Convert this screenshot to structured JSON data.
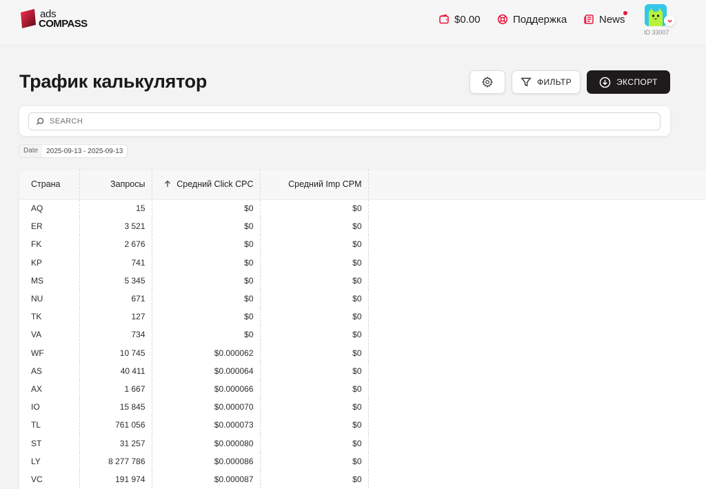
{
  "header": {
    "logo_top": "ads",
    "logo_bottom": "COMPASS",
    "balance": "$0.00",
    "support_label": "Поддержка",
    "news_label": "News",
    "user_id": "ID 33007"
  },
  "page": {
    "title": "Трафик калькулятор",
    "filter_label": "ФИЛЬТР",
    "export_label": "ЭКСПОРТ",
    "search_placeholder": "SEARCH",
    "date_label": "Date",
    "date_value": "2025-09-13 - 2025-09-13"
  },
  "table": {
    "columns": [
      "Страна",
      "Запросы",
      "Средний Click CPC",
      "Средний Imp CPM"
    ],
    "sorted_column": "Средний Click CPC",
    "rows": [
      [
        "AQ",
        "15",
        "$0",
        "$0"
      ],
      [
        "ER",
        "3 521",
        "$0",
        "$0"
      ],
      [
        "FK",
        "2 676",
        "$0",
        "$0"
      ],
      [
        "KP",
        "741",
        "$0",
        "$0"
      ],
      [
        "MS",
        "5 345",
        "$0",
        "$0"
      ],
      [
        "NU",
        "671",
        "$0",
        "$0"
      ],
      [
        "TK",
        "127",
        "$0",
        "$0"
      ],
      [
        "VA",
        "734",
        "$0",
        "$0"
      ],
      [
        "WF",
        "10 745",
        "$0.000062",
        "$0"
      ],
      [
        "AS",
        "40 411",
        "$0.000064",
        "$0"
      ],
      [
        "AX",
        "1 667",
        "$0.000066",
        "$0"
      ],
      [
        "IO",
        "15 845",
        "$0.000070",
        "$0"
      ],
      [
        "TL",
        "761 056",
        "$0.000073",
        "$0"
      ],
      [
        "ST",
        "31 257",
        "$0.000080",
        "$0"
      ],
      [
        "LY",
        "8 277 786",
        "$0.000086",
        "$0"
      ],
      [
        "VC",
        "191 974",
        "$0.000087",
        "$0"
      ]
    ]
  },
  "colors": {
    "brand_red": "#e8173f",
    "export_button": "#1f1a1c",
    "avatar_bg": "#34c8e8"
  }
}
